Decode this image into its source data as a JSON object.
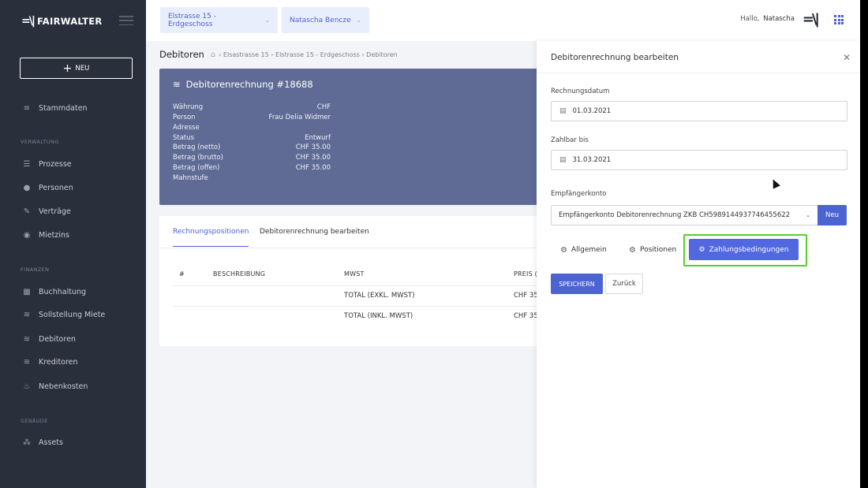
{
  "sidebar": {
    "logo_mark": "=\\|",
    "logo_text": "FAIRWALTER",
    "new_button": "NEU",
    "items": [
      {
        "label": "Stammdaten",
        "icon": "database-icon"
      },
      {
        "label": "Prozesse",
        "icon": "process-icon"
      },
      {
        "label": "Personen",
        "icon": "people-icon"
      },
      {
        "label": "Verträge",
        "icon": "contract-icon"
      },
      {
        "label": "Mietzins",
        "icon": "rent-icon"
      },
      {
        "label": "Buchhaltung",
        "icon": "ledger-icon"
      },
      {
        "label": "Sollstellung Miete",
        "icon": "coins-icon"
      },
      {
        "label": "Debitoren",
        "icon": "coins-icon"
      },
      {
        "label": "Kreditoren",
        "icon": "coins-icon"
      },
      {
        "label": "Nebenkosten",
        "icon": "flame-icon"
      },
      {
        "label": "Assets",
        "icon": "assets-icon"
      }
    ],
    "sections": [
      "VERWALTUNG",
      "FINANZEN",
      "GEBÄUDE"
    ]
  },
  "topbar": {
    "property_select": "Elstrasse 15 - Erdgeschoss",
    "person_select": "Natascha Bencze",
    "greeting": "Hallo,",
    "user_name": "Natascha",
    "brand_mark": "=\\|"
  },
  "main": {
    "page_title": "Debitoren",
    "breadcrumb": "› Elsastrasse 15 › Elstrasse 15 - Erdgeschoss › Debitoren",
    "invoice": {
      "title": "Debitorenrechnung #18688",
      "rows": [
        {
          "label": "Währung",
          "value": "CHF"
        },
        {
          "label": "Person",
          "value": "Frau Delia Widmer"
        },
        {
          "label": "Adresse",
          "value": ""
        },
        {
          "label": "Status",
          "value": "Entwurf"
        },
        {
          "label": "Betrag (netto)",
          "value": "CHF 35.00"
        },
        {
          "label": "Betrag (brutto)",
          "value": "CHF 35.00"
        },
        {
          "label": "Betrag (offen)",
          "value": "CHF 35.00"
        },
        {
          "label": "Mahnstufe",
          "value": ""
        }
      ]
    },
    "tabs": [
      "Rechnungspositionen",
      "Debitorenrechnung bearbeiten"
    ],
    "table": {
      "headers": [
        "#",
        "BESCHREIBUNG",
        "MWST",
        "PREIS ("
      ],
      "rows": [
        {
          "mwst": "TOTAL (EXKL. MWST)",
          "preis": "CHF 35"
        },
        {
          "mwst": "TOTAL (INKL. MWST)",
          "preis": "CHF 35"
        }
      ]
    }
  },
  "panel": {
    "title": "Debitorenrechnung bearbeiten",
    "close_icon": "close-icon",
    "invoice_date_label": "Rechnungsdatum",
    "invoice_date_value": "01.03.2021",
    "due_date_label": "Zahlbar bis",
    "due_date_value": "31.03.2021",
    "account_label": "Empfängerkonto",
    "account_value": "Empfängerkonto Debitorenrechnung ZKB CH5989144937746455622",
    "new_button": "Neu",
    "subtabs": [
      "Allgemein",
      "Positionen",
      "Zahlungsbedingungen"
    ],
    "save_button": "SPEICHERN",
    "back_button": "Zurück"
  },
  "colors": {
    "accent": "#4c63d2",
    "sidebar_bg": "#2a2f3c",
    "hero_bg": "#5f6b95",
    "highlight": "#55cf2e"
  }
}
